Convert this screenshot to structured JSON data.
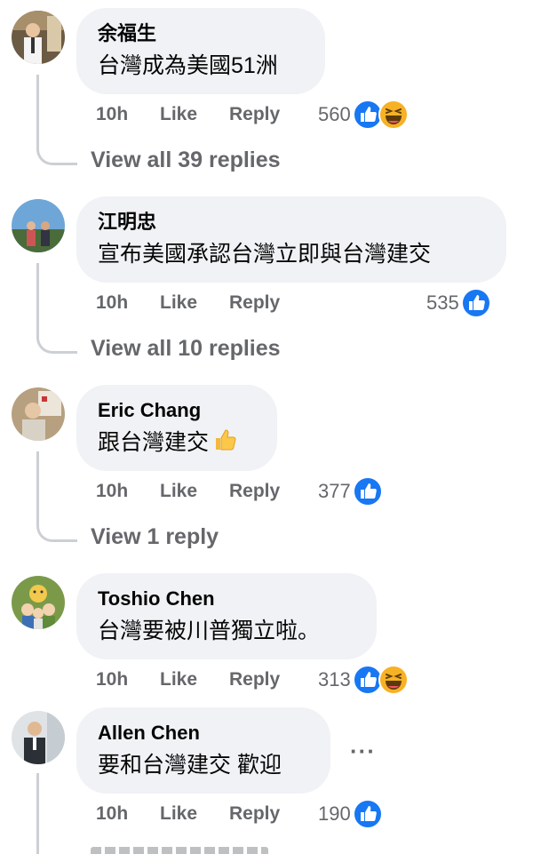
{
  "comments": [
    {
      "author": "余福生",
      "text": "台灣成為美國51洲",
      "time": "10h",
      "like": "Like",
      "reply": "Reply",
      "count": "560",
      "reactions": [
        "like-reaction-icon",
        "haha-reaction-icon"
      ],
      "view_replies": "View all 39 replies"
    },
    {
      "author": "江明忠",
      "text": "宣布美國承認台灣立即與台灣建交",
      "time": "10h",
      "like": "Like",
      "reply": "Reply",
      "count": "535",
      "reactions": [
        "like-reaction-icon"
      ],
      "view_replies": "View all 10 replies"
    },
    {
      "author": "Eric Chang",
      "text": "跟台灣建交",
      "emoji": "thumbs-up-emoji",
      "time": "10h",
      "like": "Like",
      "reply": "Reply",
      "count": "377",
      "reactions": [
        "like-reaction-icon"
      ],
      "view_replies": "View 1 reply"
    },
    {
      "author": "Toshio Chen",
      "text": "台灣要被川普獨立啦。",
      "time": "10h",
      "like": "Like",
      "reply": "Reply",
      "count": "313",
      "reactions": [
        "like-reaction-icon",
        "haha-reaction-icon"
      ]
    },
    {
      "author": "Allen Chen",
      "text": "要和台灣建交 歡迎",
      "time": "10h",
      "like": "Like",
      "reply": "Reply",
      "count": "190",
      "reactions": [
        "like-reaction-icon"
      ]
    }
  ],
  "more_menu": "···",
  "colors": {
    "bubble": "#f0f2f5",
    "secondary_text": "#65676b",
    "like_blue": "#1877f2",
    "haha_yellow": "#f7b125",
    "thread_line": "#ccd0d5"
  }
}
